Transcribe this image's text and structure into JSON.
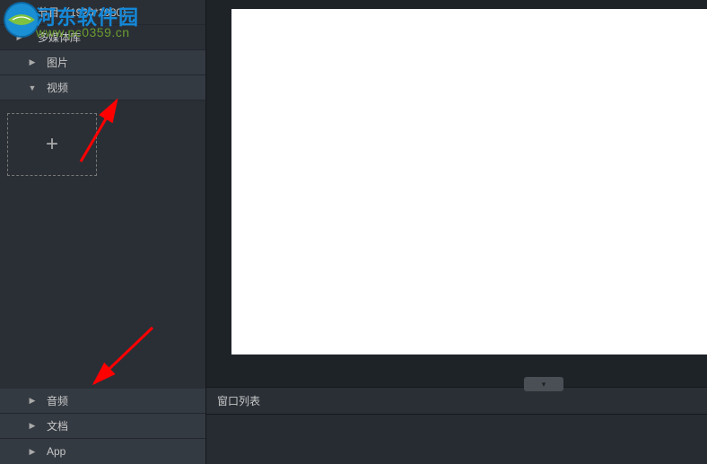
{
  "sidebar": {
    "program": {
      "label": "节目（1920*1080）",
      "arrow": "▶"
    },
    "library": {
      "label": "多媒体库",
      "arrow": "▶"
    },
    "image": {
      "label": "图片",
      "arrow": "▶"
    },
    "video": {
      "label": "视频",
      "arrow": "▼"
    },
    "addGlyph": "+",
    "audio": {
      "label": "音频",
      "arrow": "▶"
    },
    "doc": {
      "label": "文档",
      "arrow": "▶"
    },
    "app": {
      "label": "App",
      "arrow": "▶"
    }
  },
  "bottom": {
    "title": "窗口列表",
    "pillGlyph": "▾"
  },
  "watermark": {
    "line1": "河东软件园",
    "line2": "www.pc0359.cn"
  }
}
